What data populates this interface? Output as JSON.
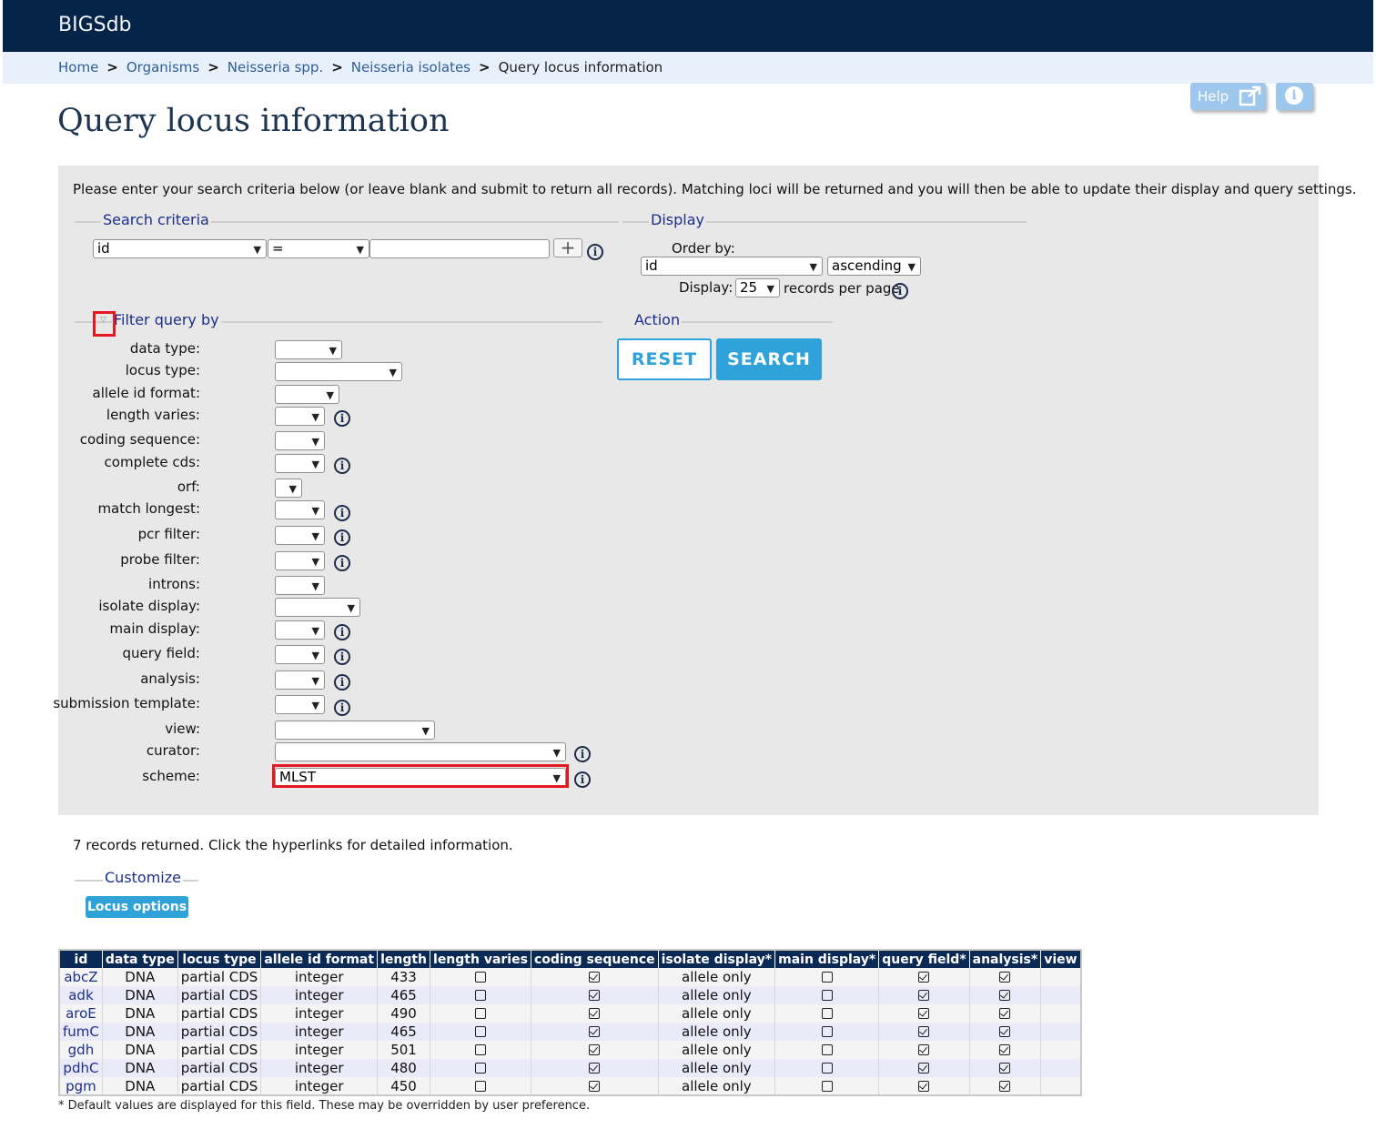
{
  "header": {
    "site_name": "BIGSdb"
  },
  "breadcrumb": [
    "Home",
    "Organisms",
    "Neisseria spp.",
    "Neisseria isolates"
  ],
  "breadcrumb_current": "Query locus information",
  "help_label": "Help",
  "page_title": "Query locus information",
  "intro": "Please enter your search criteria below (or leave blank and submit to return all records). Matching loci will be returned and you will then be able to update their display and query settings.",
  "search": {
    "legend": "Search criteria",
    "field": "id",
    "operator": "=",
    "value": ""
  },
  "display": {
    "legend": "Display",
    "order_by_label": "Order by:",
    "order_field": "id",
    "order_direction": "ascending",
    "display_label": "Display:",
    "per_page": "25",
    "per_page_suffix": "records per page"
  },
  "filter": {
    "legend": "Filter query by",
    "fields": [
      {
        "label": "data type:",
        "value": ""
      },
      {
        "label": "locus type:",
        "value": ""
      },
      {
        "label": "allele id format:",
        "value": ""
      },
      {
        "label": "length varies:",
        "value": ""
      },
      {
        "label": "coding sequence:",
        "value": ""
      },
      {
        "label": "complete cds:",
        "value": ""
      },
      {
        "label": "orf:",
        "value": ""
      },
      {
        "label": "match longest:",
        "value": ""
      },
      {
        "label": "pcr filter:",
        "value": ""
      },
      {
        "label": "probe filter:",
        "value": ""
      },
      {
        "label": "introns:",
        "value": ""
      },
      {
        "label": "isolate display:",
        "value": ""
      },
      {
        "label": "main display:",
        "value": ""
      },
      {
        "label": "query field:",
        "value": ""
      },
      {
        "label": "analysis:",
        "value": ""
      },
      {
        "label": "submission template:",
        "value": ""
      },
      {
        "label": "view:",
        "value": ""
      },
      {
        "label": "curator:",
        "value": ""
      },
      {
        "label": "scheme:",
        "value": "MLST"
      }
    ]
  },
  "action": {
    "legend": "Action",
    "reset": "RESET",
    "search": "SEARCH"
  },
  "results": {
    "summary": "7 records returned. Click the hyperlinks for detailed information.",
    "customize_legend": "Customize",
    "locus_options": "Locus options",
    "columns": [
      "id",
      "data type",
      "locus type",
      "allele id format",
      "length",
      "length varies",
      "coding sequence",
      "isolate display*",
      "main display*",
      "query field*",
      "analysis*",
      "view"
    ],
    "rows": [
      {
        "id": "abcZ",
        "data_type": "DNA",
        "locus_type": "partial CDS",
        "format": "integer",
        "length": "433",
        "length_varies": false,
        "coding": true,
        "isolate_display": "allele only",
        "main_display": false,
        "query_field": true,
        "analysis": true,
        "view": ""
      },
      {
        "id": "adk",
        "data_type": "DNA",
        "locus_type": "partial CDS",
        "format": "integer",
        "length": "465",
        "length_varies": false,
        "coding": true,
        "isolate_display": "allele only",
        "main_display": false,
        "query_field": true,
        "analysis": true,
        "view": ""
      },
      {
        "id": "aroE",
        "data_type": "DNA",
        "locus_type": "partial CDS",
        "format": "integer",
        "length": "490",
        "length_varies": false,
        "coding": true,
        "isolate_display": "allele only",
        "main_display": false,
        "query_field": true,
        "analysis": true,
        "view": ""
      },
      {
        "id": "fumC",
        "data_type": "DNA",
        "locus_type": "partial CDS",
        "format": "integer",
        "length": "465",
        "length_varies": false,
        "coding": true,
        "isolate_display": "allele only",
        "main_display": false,
        "query_field": true,
        "analysis": true,
        "view": ""
      },
      {
        "id": "gdh",
        "data_type": "DNA",
        "locus_type": "partial CDS",
        "format": "integer",
        "length": "501",
        "length_varies": false,
        "coding": true,
        "isolate_display": "allele only",
        "main_display": false,
        "query_field": true,
        "analysis": true,
        "view": ""
      },
      {
        "id": "pdhC",
        "data_type": "DNA",
        "locus_type": "partial CDS",
        "format": "integer",
        "length": "480",
        "length_varies": false,
        "coding": true,
        "isolate_display": "allele only",
        "main_display": false,
        "query_field": true,
        "analysis": true,
        "view": ""
      },
      {
        "id": "pgm",
        "data_type": "DNA",
        "locus_type": "partial CDS",
        "format": "integer",
        "length": "450",
        "length_varies": false,
        "coding": true,
        "isolate_display": "allele only",
        "main_display": false,
        "query_field": true,
        "analysis": true,
        "view": ""
      }
    ],
    "footnote": "* Default values are displayed for this field. These may be overridden by user preference."
  },
  "colors": {
    "header_bg": "#062448",
    "accent": "#2ea2d9",
    "highlight": "#e4181e"
  }
}
